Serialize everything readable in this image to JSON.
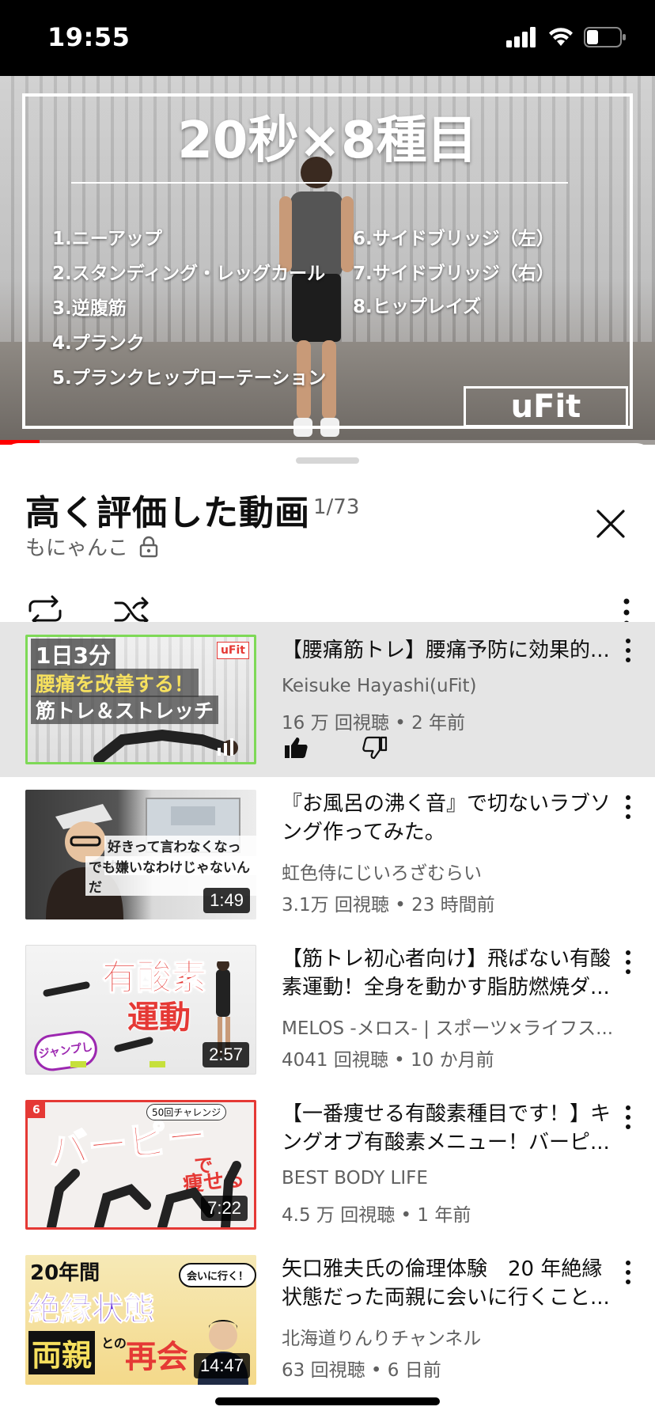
{
  "status": {
    "time": "19:55"
  },
  "player": {
    "overlay_title": "20秒×8種目",
    "items_left": [
      "1.ニーアップ",
      "2.スタンディング・レッグカール",
      "3.逆腹筋",
      "4.プランク",
      "5.プランクヒップローテーション"
    ],
    "items_right": [
      "6.サイドブリッジ（左）",
      "7.サイドブリッジ（右）",
      "8.ヒップレイズ"
    ],
    "brand": "uFit",
    "progress_fraction": 0.06
  },
  "playlist": {
    "title": "高く評価した動画",
    "position": "1/73",
    "owner": "もにゃんこ"
  },
  "videos": [
    {
      "title": "【腰痛筋トレ】腰痛予防に効果的...",
      "channel": "Keisuke Hayashi(uFit)",
      "stats": "16 万 回視聴 • 2 年前",
      "thumb_lines": [
        "1日3分",
        "腰痛を改善する！",
        "筋トレ＆ストレッチ"
      ],
      "thumb_badge": "uFit",
      "active": true
    },
    {
      "title": "『お風呂の沸く音』で切ないラブソング作ってみた。",
      "channel": "虹色侍にじいろざむらい",
      "stats": "3.1万 回視聴 • 23 時間前",
      "thumb_lines": [
        "好きって言わなくなった",
        "でも嫌いなわけじゃないんだ"
      ],
      "duration": "1:49"
    },
    {
      "title": "【筋トレ初心者向け】飛ばない有酸素運動！全身を動かす脂肪燃焼ダ...",
      "channel": "MELOS -メロス- | スポーツ×ライフス...",
      "stats": "4041 回視聴 • 10 か月前",
      "thumb_lines": [
        "有酸素",
        "運動",
        "ジャンプしない"
      ],
      "duration": "2:57"
    },
    {
      "title": "【一番痩せる有酸素種目です！】キングオブ有酸素メニュー！バーピ...",
      "channel": "BEST BODY LIFE",
      "stats": "4.5 万 回視聴 • 1 年前",
      "thumb_lines": [
        "バーピー",
        "で",
        "痩せる",
        "50回チャレンジ",
        "6"
      ],
      "duration": "7:22"
    },
    {
      "title": "矢口雅夫氏の倫理体験　20 年絶縁状態だった両親に会いに行くこと...",
      "channel": "北海道りんりチャンネル",
      "stats": "63 回視聴 • 6 日前",
      "thumb_lines": [
        "20年間",
        "絶縁状態",
        "両親",
        "との",
        "再会",
        "会いに行く！"
      ],
      "duration": "14:47"
    }
  ],
  "colors": {
    "accent_red": "#ff0000",
    "active_row": "#e5e5e5",
    "meta_gray": "#606060"
  }
}
